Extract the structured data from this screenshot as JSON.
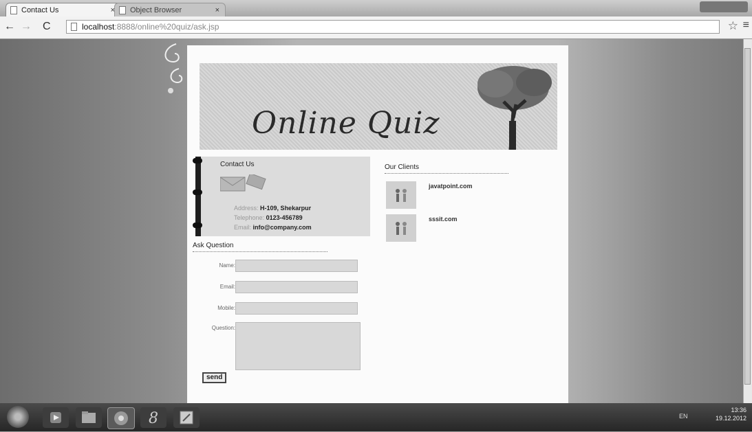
{
  "browser": {
    "tabs": [
      {
        "label": "Contact Us"
      },
      {
        "label": "Object Browser"
      }
    ],
    "url": {
      "host": "localhost",
      "path": ":8888/online%20quiz/ask.jsp"
    }
  },
  "banner": {
    "title": "Online Quiz"
  },
  "contact": {
    "title": "Contact Us",
    "address_label": "Address:",
    "address_value": "H-109, Shekarpur",
    "telephone_label": "Telephone:",
    "telephone_value": "0123-456789",
    "email_label": "Email:",
    "email_value": "info@company.com"
  },
  "ask": {
    "title": "Ask Question",
    "name_label": "Name:",
    "email_label": "Email:",
    "mobile_label": "Mobile:",
    "question_label": "Question:",
    "send_label": "send"
  },
  "clients": {
    "title": "Our Clients",
    "items": [
      {
        "name": "javatpoint.com"
      },
      {
        "name": "sssit.com"
      }
    ]
  },
  "taskbar": {
    "language": "EN",
    "time": "13:36",
    "date": "19.12.2012"
  }
}
